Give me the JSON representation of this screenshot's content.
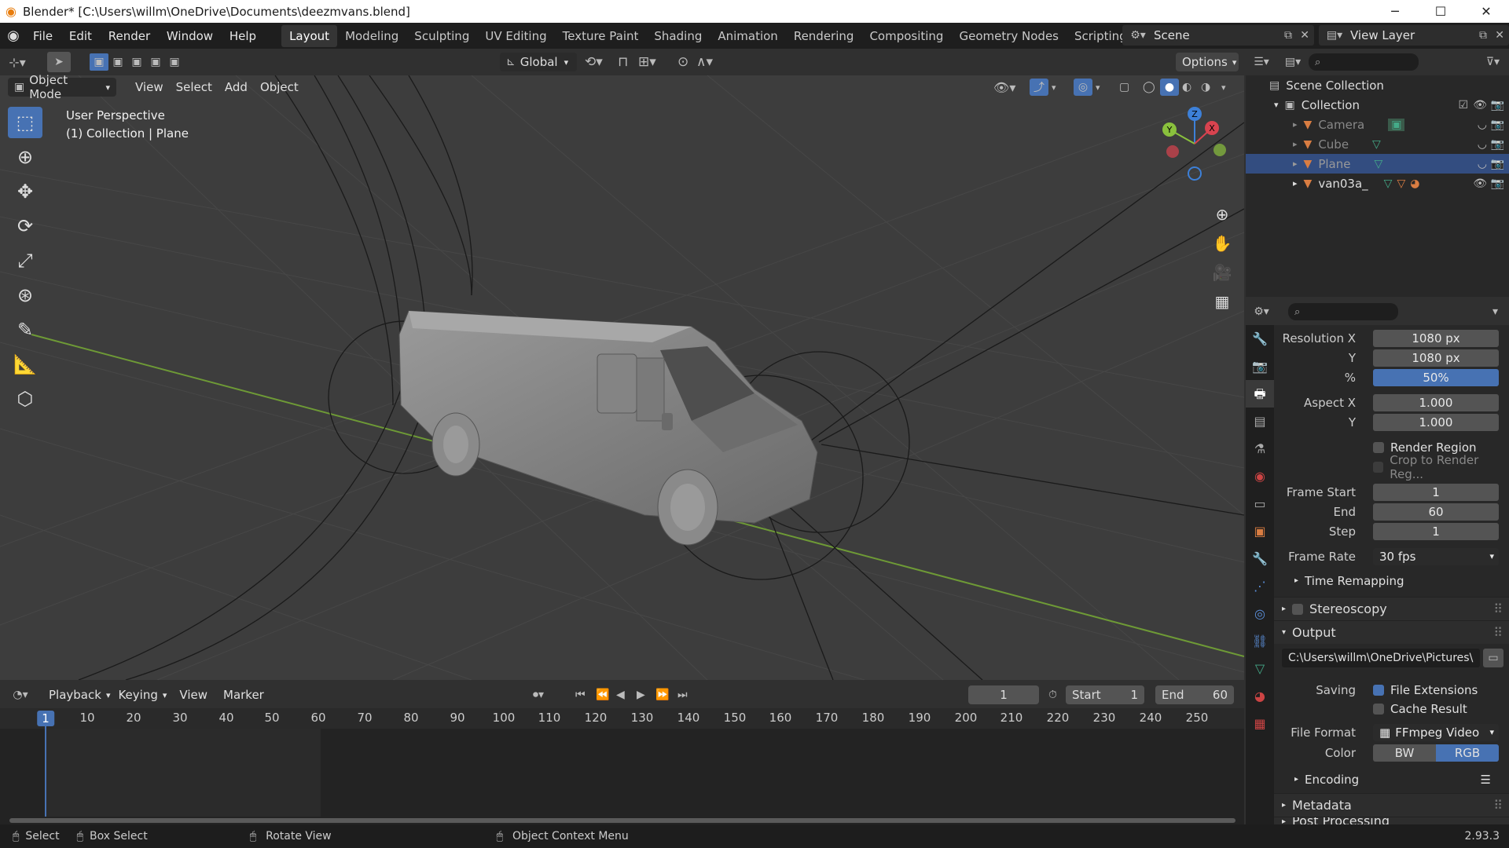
{
  "title_bar": {
    "text": "Blender* [C:\\Users\\willm\\OneDrive\\Documents\\deezmvans.blend]"
  },
  "menu": [
    "File",
    "Edit",
    "Render",
    "Window",
    "Help"
  ],
  "workspaces": [
    "Layout",
    "Modeling",
    "Sculpting",
    "UV Editing",
    "Texture Paint",
    "Shading",
    "Animation",
    "Rendering",
    "Compositing",
    "Geometry Nodes",
    "Scripting"
  ],
  "active_workspace": "Layout",
  "scene": "Scene",
  "view_layer": "View Layer",
  "viewport": {
    "transform_orientation": "Global",
    "options_label": "Options",
    "mode": "Object Mode",
    "menus": [
      "View",
      "Select",
      "Add",
      "Object"
    ],
    "info_line1": "User Perspective",
    "info_line2": "(1) Collection | Plane"
  },
  "gizmo": {
    "z": "Z",
    "y": "Y",
    "x": "X"
  },
  "outliner": {
    "root": "Scene Collection",
    "collection": "Collection",
    "items": [
      "Camera",
      "Cube",
      "Plane",
      "van03a_"
    ],
    "selected": "Plane"
  },
  "properties": {
    "resolution_x_label": "Resolution X",
    "resolution_x": "1080 px",
    "y_label": "Y",
    "resolution_y": "1080 px",
    "pct_label": "%",
    "resolution_pct": "50%",
    "aspect_x_label": "Aspect X",
    "aspect_x": "1.000",
    "aspect_y_label": "Y",
    "aspect_y": "1.000",
    "render_region": "Render Region",
    "crop": "Crop to Render Reg...",
    "frame_start_label": "Frame Start",
    "frame_start": "1",
    "end_label": "End",
    "frame_end": "60",
    "step_label": "Step",
    "frame_step": "1",
    "frame_rate_label": "Frame Rate",
    "frame_rate": "30 fps",
    "time_remapping": "Time Remapping",
    "stereoscopy": "Stereoscopy",
    "output": "Output",
    "output_path": "C:\\Users\\willm\\OneDrive\\Pictures\\",
    "saving_label": "Saving",
    "file_extensions": "File Extensions",
    "cache_result": "Cache Result",
    "file_format_label": "File Format",
    "file_format": "FFmpeg Video",
    "color_label": "Color",
    "color_bw": "BW",
    "color_rgb": "RGB",
    "encoding": "Encoding",
    "metadata": "Metadata",
    "post_processing": "Post Processing"
  },
  "timeline": {
    "menus": [
      "Playback",
      "Keying",
      "View",
      "Marker"
    ],
    "current_frame": "1",
    "start_label": "Start",
    "start": "1",
    "end_label": "End",
    "end": "60",
    "ticks": [
      "1",
      "10",
      "20",
      "30",
      "40",
      "50",
      "60",
      "70",
      "80",
      "90",
      "100",
      "110",
      "120",
      "130",
      "140",
      "150",
      "160",
      "170",
      "180",
      "190",
      "200",
      "210",
      "220",
      "230",
      "240",
      "250"
    ]
  },
  "status": {
    "select": "Select",
    "box_select": "Box Select",
    "rotate_view": "Rotate View",
    "context_menu": "Object Context Menu",
    "version": "2.93.3"
  },
  "colors": {
    "accent": "#4772b3",
    "blender_orange": "#e87d0d",
    "x_axis": "#d8434f",
    "y_axis": "#8ac13d",
    "z_axis": "#3d80d8"
  }
}
